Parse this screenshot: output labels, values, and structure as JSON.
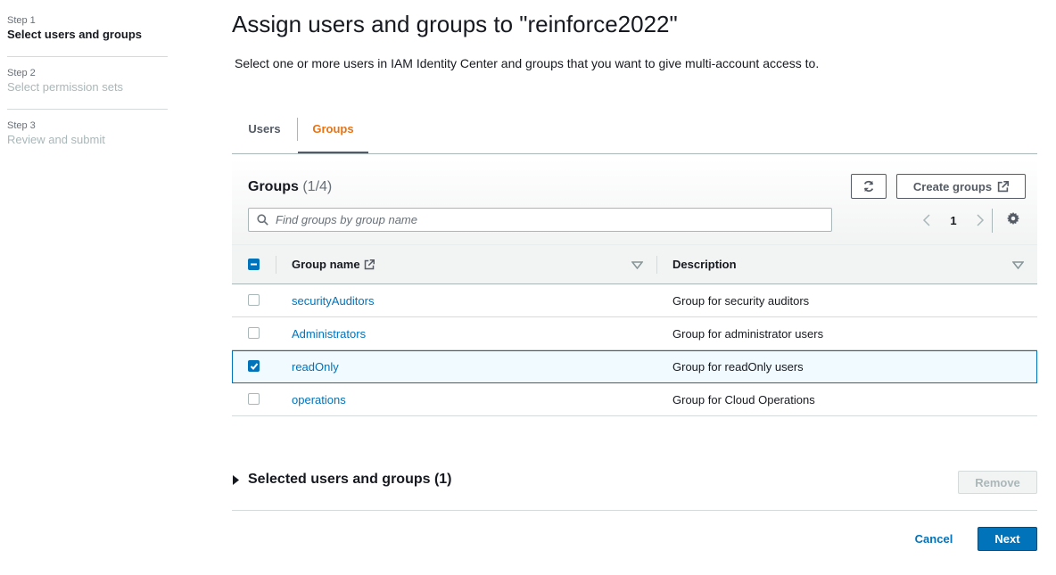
{
  "steps": [
    {
      "num": "Step 1",
      "label": "Select users and groups"
    },
    {
      "num": "Step 2",
      "label": "Select permission sets"
    },
    {
      "num": "Step 3",
      "label": "Review and submit"
    }
  ],
  "page": {
    "title": "Assign users and groups to \"reinforce2022\"",
    "description": "Select one or more users in IAM Identity Center and groups that you want to give multi-account access to."
  },
  "tabs": {
    "users": "Users",
    "groups": "Groups",
    "active": "groups"
  },
  "table": {
    "title": "Groups",
    "count": "(1/4)",
    "create_label": "Create groups",
    "search_placeholder": "Find groups by group name",
    "page": "1",
    "columns": {
      "name": "Group name",
      "description": "Description"
    },
    "rows": [
      {
        "name": "securityAuditors",
        "description": "Group for security auditors",
        "selected": false
      },
      {
        "name": "Administrators",
        "description": "Group for administrator users",
        "selected": false
      },
      {
        "name": "readOnly",
        "description": "Group for readOnly users",
        "selected": true
      },
      {
        "name": "operations",
        "description": "Group for Cloud Operations",
        "selected": false
      }
    ]
  },
  "selected_section": {
    "title": "Selected users and groups (1)",
    "remove_label": "Remove"
  },
  "footer": {
    "cancel_label": "Cancel",
    "next_label": "Next"
  },
  "colors": {
    "accent": "#ec7211",
    "link": "#0073bb",
    "primary_button": "#0073bb"
  }
}
